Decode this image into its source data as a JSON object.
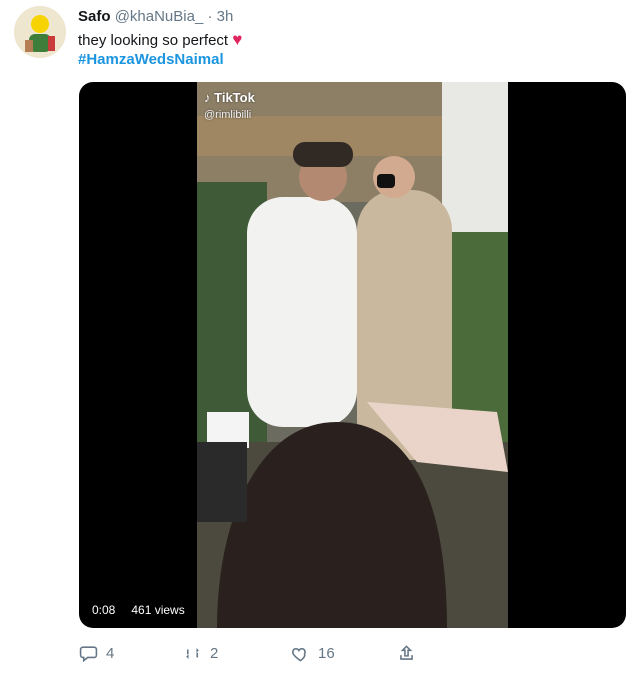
{
  "tweet": {
    "author_name": "Safo",
    "author_handle": "@khaNuBia_",
    "separator": "·",
    "time": "3h",
    "text": "they looking so perfect",
    "emoji": "♥",
    "hashtag": "#HamzaWedsNaimal"
  },
  "video": {
    "watermark_brand": "TikTok",
    "watermark_user": "@rimlibilli",
    "duration": "0:08",
    "views": "461 views"
  },
  "actions": {
    "reply_count": "4",
    "retweet_count": "2",
    "like_count": "16",
    "share_icon": "share-icon"
  },
  "colors": {
    "link": "#1b95e0",
    "muted": "#657786",
    "heart": "#e0245e"
  }
}
